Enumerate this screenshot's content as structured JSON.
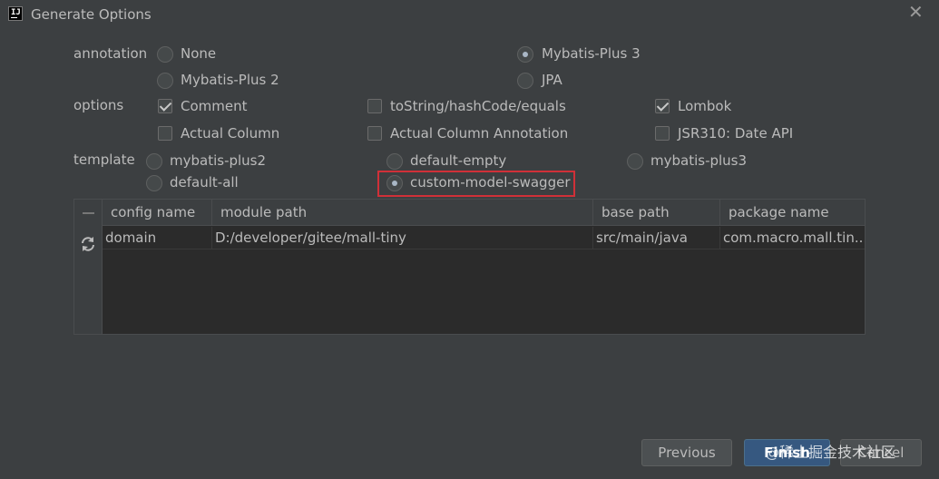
{
  "window": {
    "title": "Generate Options",
    "close_glyph": "✕",
    "app_icon": "IJ"
  },
  "annotation": {
    "label": "annotation",
    "options": [
      {
        "label": "None",
        "checked": false
      },
      {
        "label": "Mybatis-Plus 3",
        "checked": true
      },
      {
        "label": "Mybatis-Plus 2",
        "checked": false
      },
      {
        "label": "JPA",
        "checked": false
      }
    ]
  },
  "options": {
    "label": "options",
    "items": [
      {
        "label": "Comment",
        "checked": true
      },
      {
        "label": "toString/hashCode/equals",
        "checked": false
      },
      {
        "label": "Lombok",
        "checked": true
      },
      {
        "label": "Actual Column",
        "checked": false
      },
      {
        "label": "Actual Column Annotation",
        "checked": false
      },
      {
        "label": "JSR310: Date API",
        "checked": false
      }
    ]
  },
  "template": {
    "label": "template",
    "options": [
      {
        "label": "mybatis-plus2",
        "checked": false
      },
      {
        "label": "default-empty",
        "checked": false
      },
      {
        "label": "mybatis-plus3",
        "checked": false
      },
      {
        "label": "default-all",
        "checked": false
      },
      {
        "label": "custom-model-swagger",
        "checked": true
      }
    ]
  },
  "table": {
    "columns": [
      "config name",
      "module path",
      "base path",
      "package name"
    ],
    "rows": [
      [
        "domain",
        "D:/developer/gitee/mall-tiny",
        "src/main/java",
        "com.macro.mall.tin..."
      ]
    ],
    "toolbar": {
      "minus_icon": "minus-icon",
      "refresh_icon": "refresh-icon"
    }
  },
  "buttons": {
    "previous": "Previous",
    "finish": "Finish",
    "cancel": "Cancel"
  },
  "watermark": "@稀土掘金技术社区",
  "colors": {
    "background": "#3c3f41",
    "highlight": "#d03038",
    "primary_button": "#365880"
  }
}
